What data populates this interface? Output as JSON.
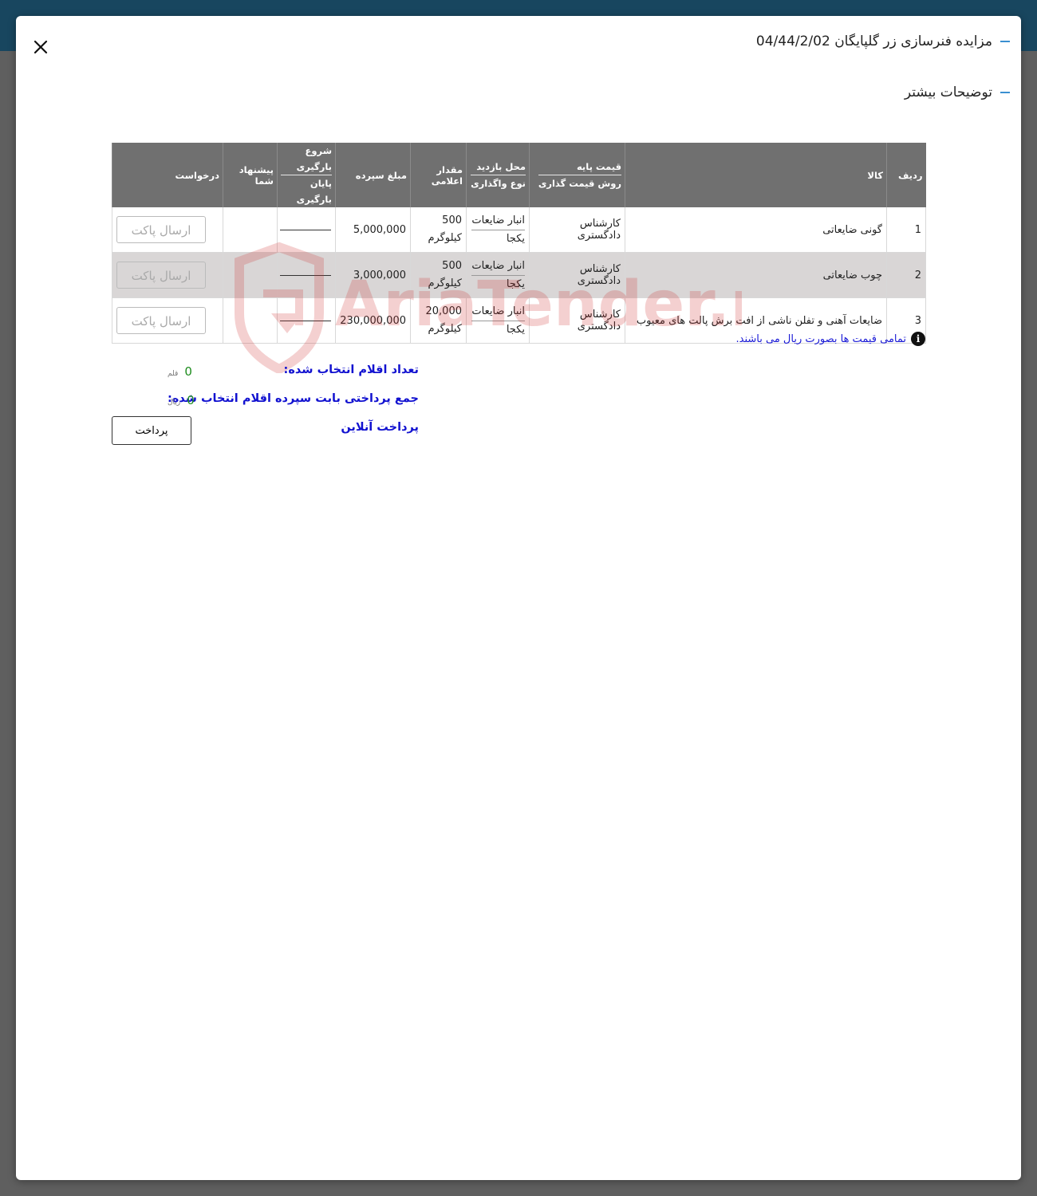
{
  "modal": {
    "title": "مزایده فنرسازی زر گلپایگان 04/44/2/02",
    "section_title": "توضیحات بیشتر",
    "close_icon": "close-icon"
  },
  "watermark": {
    "text": "AriaTender.neT"
  },
  "table": {
    "headers": {
      "row_no": "ردیف",
      "item": "کالا",
      "base_price": "قیمت پایه",
      "pricing_method": "روش قیمت گذاری",
      "visit_place": "محل بازدید",
      "transfer_type": "نوع واگذاری",
      "quantity": "مقدار اعلامی",
      "deposit": "مبلغ سپرده",
      "load_start": "شروع بارگیری",
      "load_end": "پایان بارگیری",
      "your_offer": "پیشنهاد شما",
      "request": "درخواست"
    },
    "rows": [
      {
        "row_no": "1",
        "item": "گونی ضایعاتی",
        "pricing_method": "کارشناس دادگستری",
        "visit_place": "انبار ضایعات",
        "transfer_type": "یکجا",
        "quantity": "500",
        "unit": "کیلوگرم",
        "deposit": "5,000,000",
        "request_button": "ارسال پاکت"
      },
      {
        "row_no": "2",
        "item": "چوب ضایعاتی",
        "pricing_method": "کارشناس دادگستری",
        "visit_place": "انبار ضایعات",
        "transfer_type": "یکجا",
        "quantity": "500",
        "unit": "کیلوگرم",
        "deposit": "3,000,000",
        "request_button": "ارسال پاکت"
      },
      {
        "row_no": "3",
        "item": "ضایعات آهنی و تفلن ناشی از افت برش پالت های معیوب",
        "pricing_method": "کارشناس دادگستری",
        "visit_place": "انبار ضایعات",
        "transfer_type": "یکجا",
        "quantity": "20,000",
        "unit": "کیلوگرم",
        "deposit": "230,000,000",
        "request_button": "ارسال پاکت"
      }
    ]
  },
  "note": {
    "icon": "info-icon",
    "text": "تمامی قیمت ها بصورت ریال می باشند."
  },
  "summary": {
    "selected_count_label": "تعداد اقلام انتخاب شده:",
    "selected_count_value": "0",
    "selected_count_unit": "قلم",
    "total_deposit_label": "جمع پرداختی بابت سپرده اقلام انتخاب شده:",
    "total_deposit_value": "0",
    "total_deposit_unit": "ریال",
    "online_payment_label": "پرداخت آنلاین",
    "pay_button": "پرداخت"
  },
  "colors": {
    "topbar": "#18465f",
    "header_bg": "#707070",
    "accent_dash": "#3a8fd1",
    "label_blue": "#1212d0",
    "value_green": "#1e8c1e",
    "watermark": "#d03030"
  }
}
